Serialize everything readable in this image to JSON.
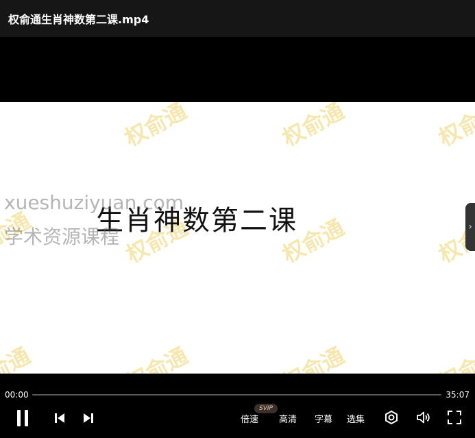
{
  "window": {
    "title": "权俞通生肖神数第二课.mp4"
  },
  "video": {
    "slide_title": "生肖神数第二课",
    "watermark_text": "权俞通",
    "overlay_site": "xueshuziyuan.com",
    "overlay_name": "学术资源课程",
    "side_handle_icon": "chevron-right-icon"
  },
  "controls": {
    "current_time": "00:00",
    "duration": "35:07",
    "progress_fraction": 0,
    "speed_label": "倍速",
    "quality_label": "高清",
    "quality_badge": "SVIP",
    "subtitle_label": "字幕",
    "episodes_label": "选集",
    "icons": [
      "pause-icon",
      "previous-icon",
      "next-icon",
      "settings-icon",
      "volume-icon",
      "fullscreen-icon"
    ]
  },
  "colors": {
    "watermark": "#EED46E",
    "titlebar_bg": "#161616",
    "badge_text": "#E9C7A7"
  }
}
